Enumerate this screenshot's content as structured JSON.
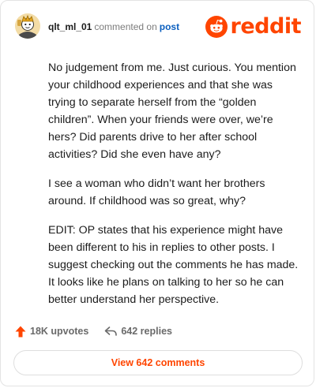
{
  "header": {
    "username": "qlt_ml_01",
    "action_text": "commented on",
    "post_link": "post",
    "brand": "reddit",
    "brand_color": "#ff4500"
  },
  "comment": {
    "paragraphs": [
      "No judgement from me. Just curious. You mention your childhood experiences and that she was trying to separate herself from the “golden children”. When your friends were over, we’re hers? Did parents drive to her after school activities? Did she even have any?",
      "I see a woman who didn’t want her brothers around. If childhood was so great, why?",
      "EDIT: OP states that his experience might have been different to his in replies to other posts. I suggest checking out the comments he has made. It looks like he plans on talking to her so he can better understand her perspective."
    ]
  },
  "actions": {
    "upvotes": "18K upvotes",
    "upvote_icon": "upvote-arrow-icon",
    "upvote_color": "#ff4500",
    "replies": "642 replies",
    "reply_icon": "reply-arrow-icon"
  },
  "footer": {
    "view_button": "View 642 comments"
  }
}
